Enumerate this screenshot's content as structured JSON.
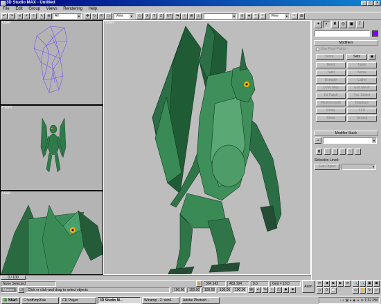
{
  "window": {
    "title": "3D Studio MAX - Untitled",
    "min_glyph": "_",
    "max_glyph": "□",
    "close_glyph": "x"
  },
  "menu": [
    "File",
    "Edit",
    "Group",
    "Views",
    "Rendering",
    "Help"
  ],
  "toolbar": {
    "selection_filter": "All",
    "view_coord_1": "View",
    "view_coord_2": "View",
    "axis_x": "X",
    "axis_y": "Y",
    "axis_z": "Z",
    "axis_xy": "XY",
    "named_selection": ""
  },
  "viewports": {
    "top_left": "User",
    "front": "Front",
    "bottom_left": "User",
    "main": "User"
  },
  "panel": {
    "tabs": [
      "create-icon",
      "modify-icon",
      "hierarchy-icon",
      "motion-icon",
      "display-icon",
      "utilities-icon"
    ],
    "tab_glyphs": [
      "✦",
      "◐",
      "♜",
      "◎",
      "▣",
      "T"
    ],
    "modifiers_title": "Modifiers",
    "use_pivot_label": "Use Pivot Points",
    "more_label": "More",
    "sets_label": "Sets",
    "modifier_buttons": [
      "Bend",
      "Taper",
      "Twist",
      "Noise",
      "Extrude",
      "Lathe",
      "UVW Map",
      "Edit Mesh",
      "Ed Patch",
      "Vol. Select",
      "MeshSmooth",
      "Displace",
      "Relax",
      "FFD",
      "Skew",
      "Stretch"
    ],
    "stack_title": "Modifier Stack",
    "selection_level_label": "Selection Level:",
    "sub_object_label": "Sub-Object",
    "accent_color": "#8000ff"
  },
  "status": {
    "selection": "None Selected",
    "prompt": "Click or click-and-drag to select objects",
    "x": "304.142",
    "y": "403.104",
    "z": "0.0",
    "grid": "Grid = 10.0",
    "frame": "0 / 100",
    "animate_label": "Anim",
    "macro_label": "Maxscr",
    "spinner_vals": [
      "100.00",
      "100.00",
      "100.00",
      "100.00",
      "100.00"
    ]
  },
  "taskbar": {
    "start": "Start",
    "buttons": [
      "C:\\soft\\mp3\\sk",
      "CD Player",
      "3D Studio M...",
      "Winamp - 2. skin1",
      "Adobe Photosh..."
    ],
    "clock": "1:32 PM"
  }
}
